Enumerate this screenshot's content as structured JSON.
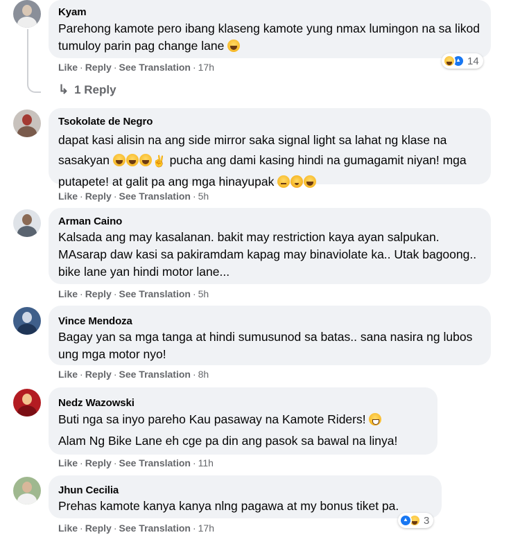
{
  "colors": {
    "bubble": "#f0f2f5",
    "secondary_text": "#65676b",
    "like_blue": "#1877f2",
    "haha_yellow": "#f7b928"
  },
  "action_labels": {
    "like": "Like",
    "reply": "Reply",
    "see_translation": "See Translation"
  },
  "comments": [
    {
      "author": "Kyam",
      "lines": [
        "Parehong kamote pero ibang klaseng kamote yung nmax lumingon na sa likod tumuloy parin pag change lane"
      ],
      "time": "17h",
      "reactions": {
        "icons": [
          "haha-icon",
          "like-icon"
        ],
        "count": "14"
      },
      "replies_label": "1 Reply"
    },
    {
      "author": "Tsokolate de Negro",
      "lines": [
        "dapat kasi alisin na ang side mirror saka signal light sa lahat ng klase na sasakyan",
        "pucha ang dami kasing hindi na gumagamit niyan! mga putapete! at galit pa ang mga hinayupak"
      ],
      "time": "5h"
    },
    {
      "author": "Arman Caino",
      "lines": [
        "Kalsada ang may kasalanan. bakit may restriction kaya ayan salpukan. MAsarap daw kasi sa pakiramdam kapag may binaviolate ka.. Utak bagoong.. bike lane yan hindi motor lane..."
      ],
      "time": "5h"
    },
    {
      "author": "Vince Mendoza",
      "lines": [
        "Bagay yan sa mga tanga at hindi sumusunod sa batas.. sana nasira ng lubos ung mga motor nyo!"
      ],
      "time": "8h"
    },
    {
      "author": "Nedz Wazowski",
      "lines": [
        "Buti nga sa inyo pareho Kau pasaway na Kamote Riders!",
        "Alam Ng Bike Lane eh cge pa din ang pasok sa bawal na linya!"
      ],
      "time": "11h"
    },
    {
      "author": "Jhun Cecilia",
      "lines": [
        "Prehas kamote kanya kanya nlng pagawa at my bonus tiket pa."
      ],
      "time": "17h",
      "reactions": {
        "icons": [
          "like-icon",
          "haha-icon"
        ],
        "count": "3"
      }
    }
  ]
}
